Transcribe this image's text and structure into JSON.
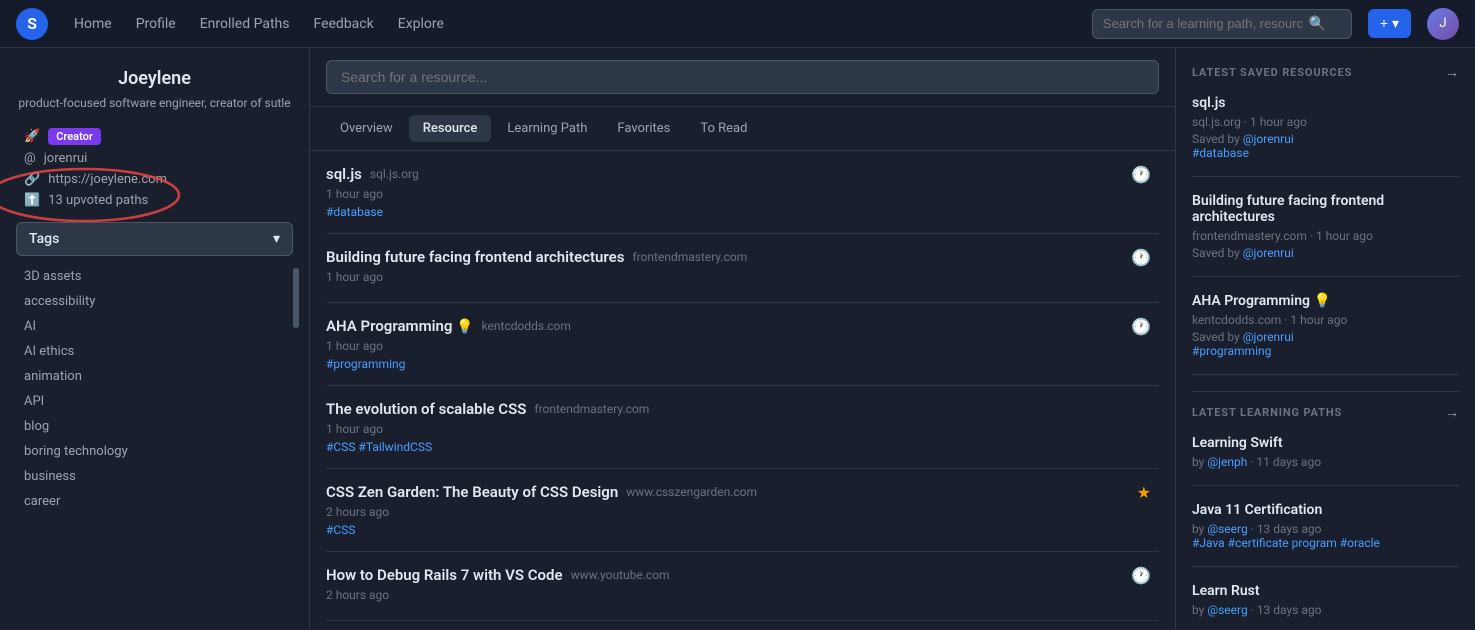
{
  "navbar": {
    "logo_text": "S",
    "links": [
      {
        "label": "Home",
        "id": "home"
      },
      {
        "label": "Profile",
        "id": "profile"
      },
      {
        "label": "Enrolled Paths",
        "id": "enrolled-paths"
      },
      {
        "label": "Feedback",
        "id": "feedback"
      },
      {
        "label": "Explore",
        "id": "explore"
      }
    ],
    "search_placeholder": "Search for a learning path, resource...",
    "add_button_label": "+ ▾",
    "avatar_text": "J"
  },
  "sidebar": {
    "profile_name": "Joeylene",
    "profile_desc": "product-focused software engineer, creator of sutle",
    "meta": [
      {
        "icon": "🚀",
        "text": "Creator",
        "is_badge": true,
        "id": "creator"
      },
      {
        "icon": "@",
        "text": "jorenrui",
        "id": "username"
      },
      {
        "icon": "🔗",
        "text": "https://joeylene.com",
        "id": "website"
      },
      {
        "icon": "⬆️",
        "text": "13 upvoted paths",
        "id": "upvoted"
      }
    ],
    "tags_label": "Tags",
    "tags": [
      "3D assets",
      "accessibility",
      "AI",
      "AI ethics",
      "animation",
      "API",
      "blog",
      "boring technology",
      "business",
      "career"
    ]
  },
  "content": {
    "search_placeholder": "Search for a resource...",
    "tabs": [
      {
        "label": "Overview",
        "id": "overview"
      },
      {
        "label": "Resource",
        "id": "resource",
        "active": true
      },
      {
        "label": "Learning Path",
        "id": "learning-path"
      },
      {
        "label": "Favorites",
        "id": "favorites"
      },
      {
        "label": "To Read",
        "id": "to-read"
      }
    ],
    "resources": [
      {
        "title": "sql.js",
        "domain": "sql.js.org",
        "time": "1 hour ago",
        "tags": "#database",
        "icon": "clock",
        "emoji": null
      },
      {
        "title": "Building future facing frontend architectures",
        "domain": "frontendmastery.com",
        "time": "1 hour ago",
        "tags": "",
        "icon": "clock",
        "emoji": null
      },
      {
        "title": "AHA Programming",
        "domain": "kentcdodds.com",
        "time": "1 hour ago",
        "tags": "#programming",
        "icon": "clock",
        "emoji": "💡"
      },
      {
        "title": "The evolution of scalable CSS",
        "domain": "frontendmastery.com",
        "time": "1 hour ago",
        "tags": "#CSS #TailwindCSS",
        "icon": null,
        "emoji": null
      },
      {
        "title": "CSS Zen Garden: The Beauty of CSS Design",
        "domain": "www.csszengarden.com",
        "time": "2 hours ago",
        "tags": "#CSS",
        "icon": "star",
        "emoji": null
      },
      {
        "title": "How to Debug Rails 7 with VS Code",
        "domain": "www.youtube.com",
        "time": "2 hours ago",
        "tags": "",
        "icon": "clock",
        "emoji": null
      }
    ]
  },
  "right_panel": {
    "latest_saved_title": "LATEST SAVED RESOURCES",
    "latest_learning_title": "LATEST LEARNING PATHS",
    "saved_resources": [
      {
        "title": "sql.js",
        "domain": "sql.js.org",
        "time": "1 hour ago",
        "saved_by": "@jorenrui",
        "tag": "#database"
      },
      {
        "title": "Building future facing frontend architectures",
        "domain": "frontendmastery.com",
        "time": "1 hour ago",
        "saved_by": "@jorenrui",
        "tag": ""
      },
      {
        "title": "AHA Programming 💡",
        "domain": "kentcdodds.com",
        "time": "1 hour ago",
        "saved_by": "@jorenrui",
        "tag": "#programming"
      }
    ],
    "learning_paths": [
      {
        "title": "Learning Swift",
        "author": "@jenph",
        "time": "11 days ago",
        "tags": ""
      },
      {
        "title": "Java 11 Certification",
        "author": "@seerg",
        "time": "13 days ago",
        "tags": "#Java #certificate program #oracle"
      },
      {
        "title": "Learn Rust",
        "author": "@seerg",
        "time": "13 days ago",
        "tags": ""
      }
    ]
  }
}
